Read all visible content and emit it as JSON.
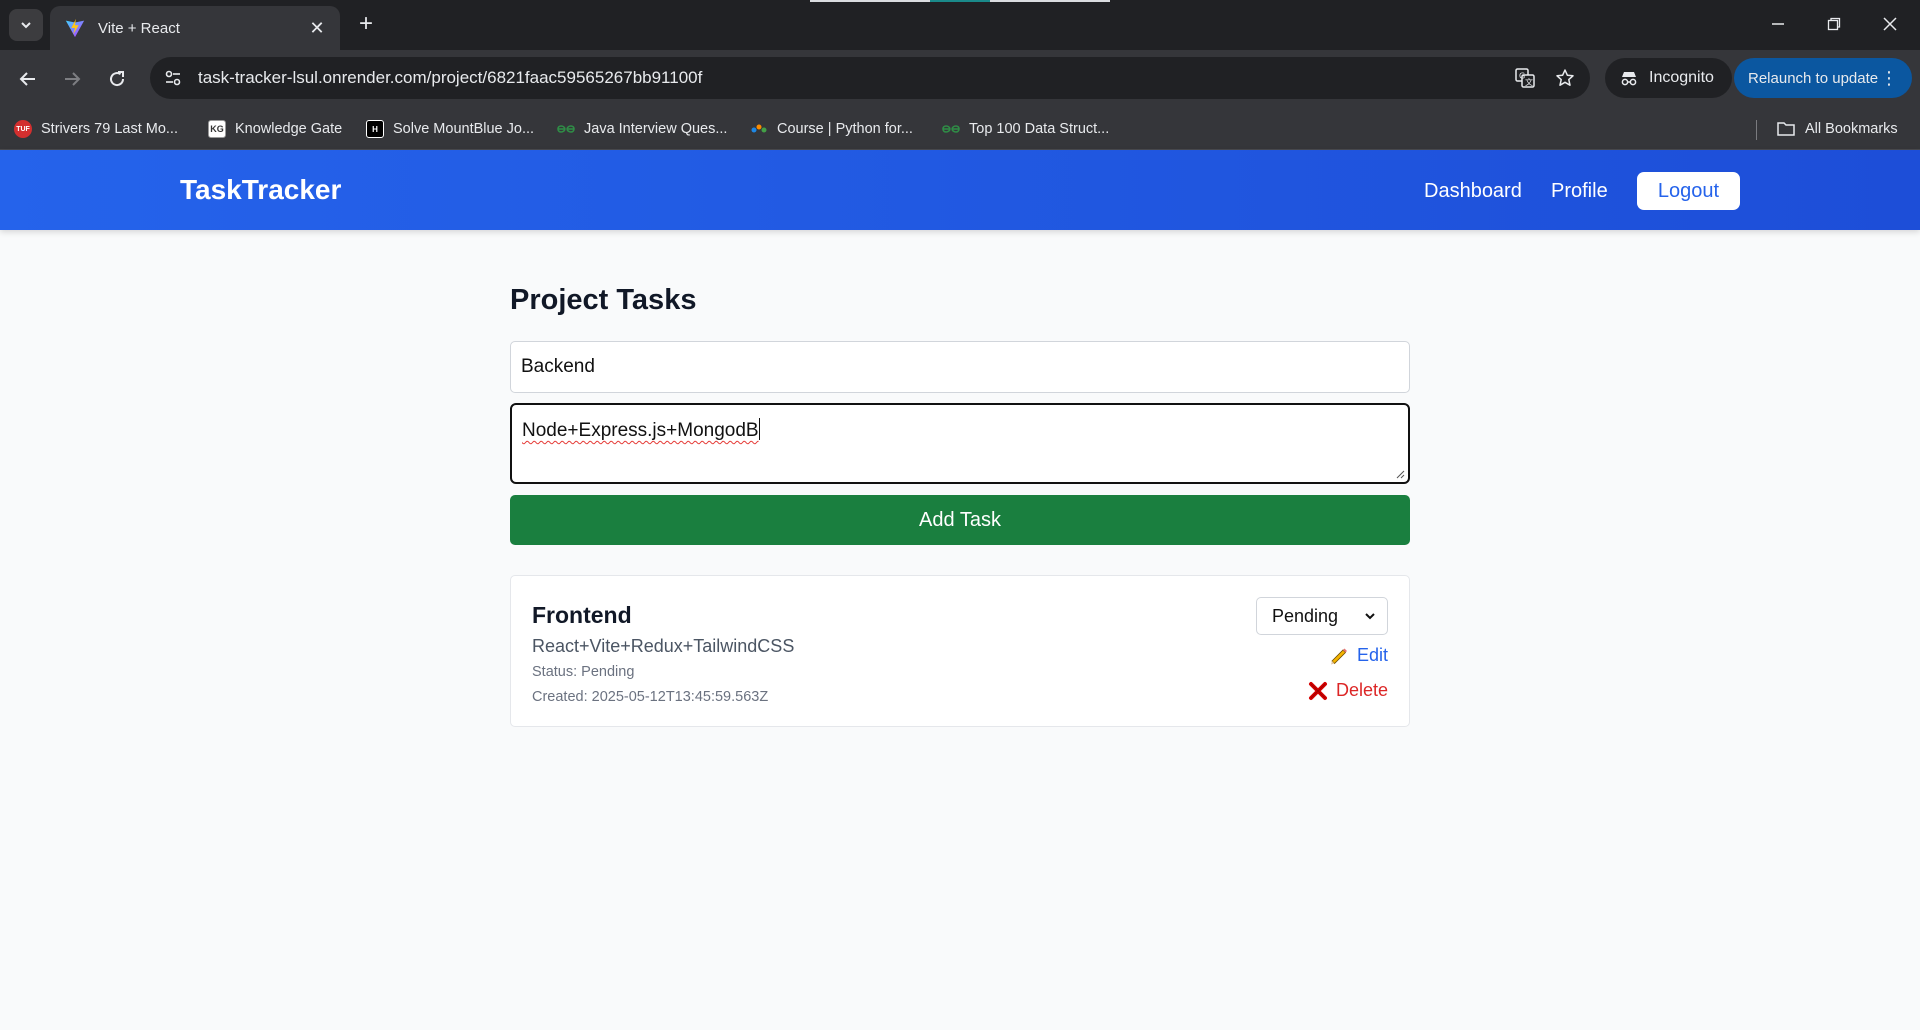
{
  "browser": {
    "tab_title": "Vite + React",
    "url": "task-tracker-lsul.onrender.com/project/6821faac59565267bb91100f",
    "incognito_label": "Incognito",
    "relaunch_label": "Relaunch to update",
    "bookmarks": [
      {
        "label": "Strivers 79 Last Mo...",
        "icon": "tuf-icon"
      },
      {
        "label": "Knowledge Gate",
        "icon": "kg-icon"
      },
      {
        "label": "Solve MountBlue Jo...",
        "icon": "hackerrank-icon"
      },
      {
        "label": "Java Interview Ques...",
        "icon": "gfg-icon"
      },
      {
        "label": "Course | Python for...",
        "icon": "course-icon"
      },
      {
        "label": "Top 100 Data Struct...",
        "icon": "gfg-icon"
      }
    ],
    "all_bookmarks_label": "All Bookmarks"
  },
  "app": {
    "brand": "TaskTracker",
    "nav": {
      "dashboard": "Dashboard",
      "profile": "Profile",
      "logout": "Logout"
    },
    "page_title": "Project Tasks",
    "form": {
      "title_value": "Backend",
      "description_value": "Node+Express.js+MongodB",
      "add_button": "Add Task"
    },
    "tasks": [
      {
        "title": "Frontend",
        "description": "React+Vite+Redux+TailwindCSS",
        "status_line": "Status: Pending",
        "created_line": "Created: 2025-05-12T13:45:59.563Z",
        "select_value": "Pending",
        "edit_label": "Edit",
        "delete_label": "Delete"
      }
    ]
  },
  "colors": {
    "header_blue": "#2563eb",
    "add_green": "#1a7f3f",
    "edit_blue": "#2563eb",
    "delete_red": "#dc2626"
  }
}
